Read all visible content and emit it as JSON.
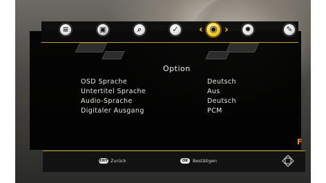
{
  "menu": {
    "icons": [
      "document-icon",
      "picture-icon",
      "search-icon",
      "clock-check-icon",
      "globe-icon",
      "gear-icon",
      "tools-icon"
    ],
    "selected_index": 4,
    "prev_arrow": "‹",
    "next_arrow": "›"
  },
  "panel": {
    "title": "Option",
    "rows": [
      {
        "label": "OSD Sprache",
        "value": "Deutsch"
      },
      {
        "label": "Untertitel Sprache",
        "value": "Aus"
      },
      {
        "label": "Audio-Sprache",
        "value": "Deutsch"
      },
      {
        "label": "Digitaler Ausgang",
        "value": "PCM"
      }
    ]
  },
  "footer": {
    "exit_key": "EXIT",
    "exit_label": "Zurück",
    "ok_key": "OK",
    "ok_label": "Bestätigen",
    "nav_icon": "dpad-icon"
  },
  "colors": {
    "accent": "#f2c41f",
    "panel_bg": "#000000",
    "text": "#eaeaea"
  }
}
